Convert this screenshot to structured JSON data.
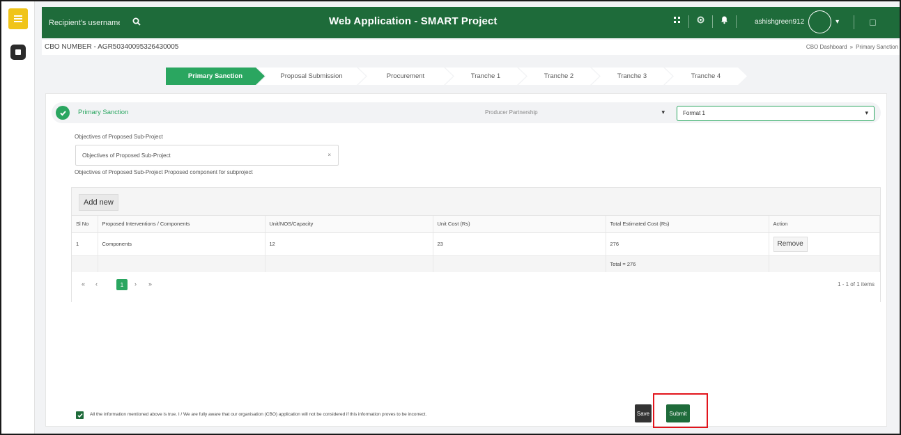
{
  "search": {
    "placeholder": "Recipient's username"
  },
  "app": {
    "title": "Web Application - SMART Project"
  },
  "user": {
    "name": "ashishgreen912"
  },
  "header": {
    "cbo_number": "CBO NUMBER - AGR50340095326430005",
    "breadcrumb": [
      "CBO Dashboard",
      "»",
      "Primary Sanction"
    ]
  },
  "steps": [
    "Primary Sanction",
    "Proposal Submission",
    "Procurement",
    "Tranche 1",
    "Tranche 2",
    "Tranche 3",
    "Tranche 4"
  ],
  "section": {
    "title": "Primary Sanction",
    "producer_select": "Producer Partnership",
    "format_select": "Format 1"
  },
  "objectives": {
    "label": "Objectives of Proposed Sub-Project",
    "select_value": "Objectives of Proposed Sub-Project",
    "clear_icon": "×",
    "hint": "Objectives of Proposed Sub-Project Proposed component for subproject"
  },
  "grid": {
    "add_new": "Add new",
    "columns": [
      "Sl No",
      "Proposed Interventions / Components",
      "Unit/NOS/Capacity",
      "Unit Cost (Rs)",
      "Total Estimated Cost (Rs)",
      "Action"
    ],
    "rows": [
      {
        "sl": "1",
        "component": "Components",
        "unit": "12",
        "unit_cost": "23",
        "total": "276",
        "action": "Remove"
      }
    ],
    "total_label": "Total = 276",
    "pager": {
      "first": "«",
      "prev": "‹",
      "page": "1",
      "next": "›",
      "last": "»",
      "info": "1 - 1 of 1 items"
    }
  },
  "footer": {
    "agreement": "All the information mentioned above is true. I / We are fully aware that our organisation (CBO) application will not be considered if this information proves to be incorrect.",
    "save": "Save",
    "submit": "Submit"
  },
  "colors": {
    "brand_green": "#1e6b3a",
    "accent_green": "#2aa660",
    "menu_yellow": "#f0c419",
    "highlight_red": "#e2141c"
  },
  "icons": [
    "menu-icon",
    "app-icon",
    "search-icon",
    "grid-icon",
    "settings-icon",
    "bell-icon",
    "avatar",
    "check-icon"
  ]
}
